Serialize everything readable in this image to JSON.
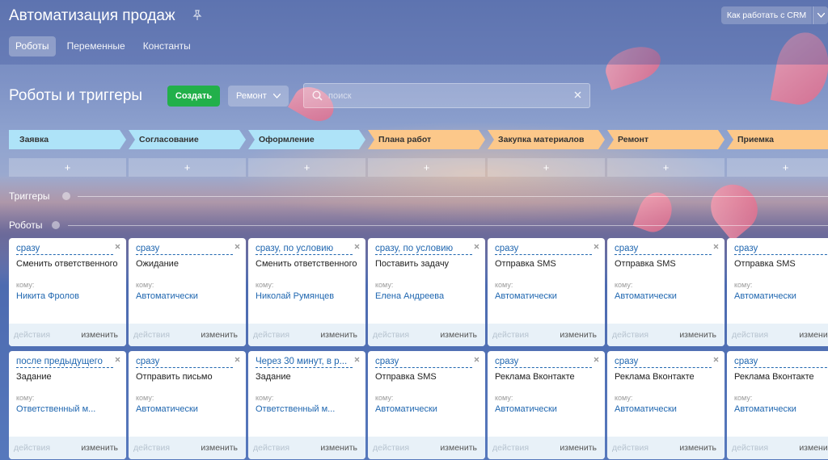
{
  "header": {
    "title": "Автоматизация продаж",
    "help_button": "Как работать с CRM",
    "tabs": [
      {
        "label": "Роботы",
        "active": true
      },
      {
        "label": "Переменные",
        "active": false
      },
      {
        "label": "Константы",
        "active": false
      }
    ]
  },
  "toolbar": {
    "section_title": "Роботы и триггеры",
    "create_label": "Создать",
    "filter_label": "Ремонт",
    "search_placeholder": "поиск"
  },
  "stages": [
    {
      "label": "Заявка",
      "color": "#aee3f8"
    },
    {
      "label": "Согласование",
      "color": "#aee3f8"
    },
    {
      "label": "Оформление",
      "color": "#aee3f8"
    },
    {
      "label": "Плана работ",
      "color": "#fcc88a"
    },
    {
      "label": "Закупка материалов",
      "color": "#fcc88a"
    },
    {
      "label": "Ремонт",
      "color": "#fcc88a"
    },
    {
      "label": "Приемка",
      "color": "#fcc88a"
    }
  ],
  "add_symbol": "+",
  "triggers_label": "Триггеры",
  "robots_label": "Роботы",
  "card_labels": {
    "to": "кому:",
    "actions": "действия",
    "edit": "изменить"
  },
  "robots": [
    [
      {
        "trigger": "сразу",
        "title": "Сменить ответственного",
        "to": "Никита Фролов"
      },
      {
        "trigger": "после предыдущего",
        "title": "Задание",
        "to": "Ответственный м..."
      }
    ],
    [
      {
        "trigger": "сразу",
        "title": "Ожидание",
        "to": "Автоматически"
      },
      {
        "trigger": "сразу",
        "title": "Отправить письмо",
        "to": "Автоматически"
      }
    ],
    [
      {
        "trigger": "сразу, по условию",
        "title": "Сменить ответственного",
        "to": "Николай Румянцев"
      },
      {
        "trigger": "Через 30 минут, в р...",
        "title": "Задание",
        "to": "Ответственный м..."
      }
    ],
    [
      {
        "trigger": "сразу, по условию",
        "title": "Поставить задачу",
        "to": "Елена Андреева"
      },
      {
        "trigger": "сразу",
        "title": "Отправка SMS",
        "to": "Автоматически"
      }
    ],
    [
      {
        "trigger": "сразу",
        "title": "Отправка SMS",
        "to": "Автоматически"
      },
      {
        "trigger": "сразу",
        "title": "Реклама Вконтакте",
        "to": "Автоматически"
      }
    ],
    [
      {
        "trigger": "сразу",
        "title": "Отправка SMS",
        "to": "Автоматически"
      },
      {
        "trigger": "сразу",
        "title": "Реклама Вконтакте",
        "to": "Автоматически"
      }
    ],
    [
      {
        "trigger": "сразу",
        "title": "Отправка SMS",
        "to": "Автоматически"
      },
      {
        "trigger": "сразу",
        "title": "Реклама Вконтакте",
        "to": "Автоматически"
      }
    ]
  ]
}
